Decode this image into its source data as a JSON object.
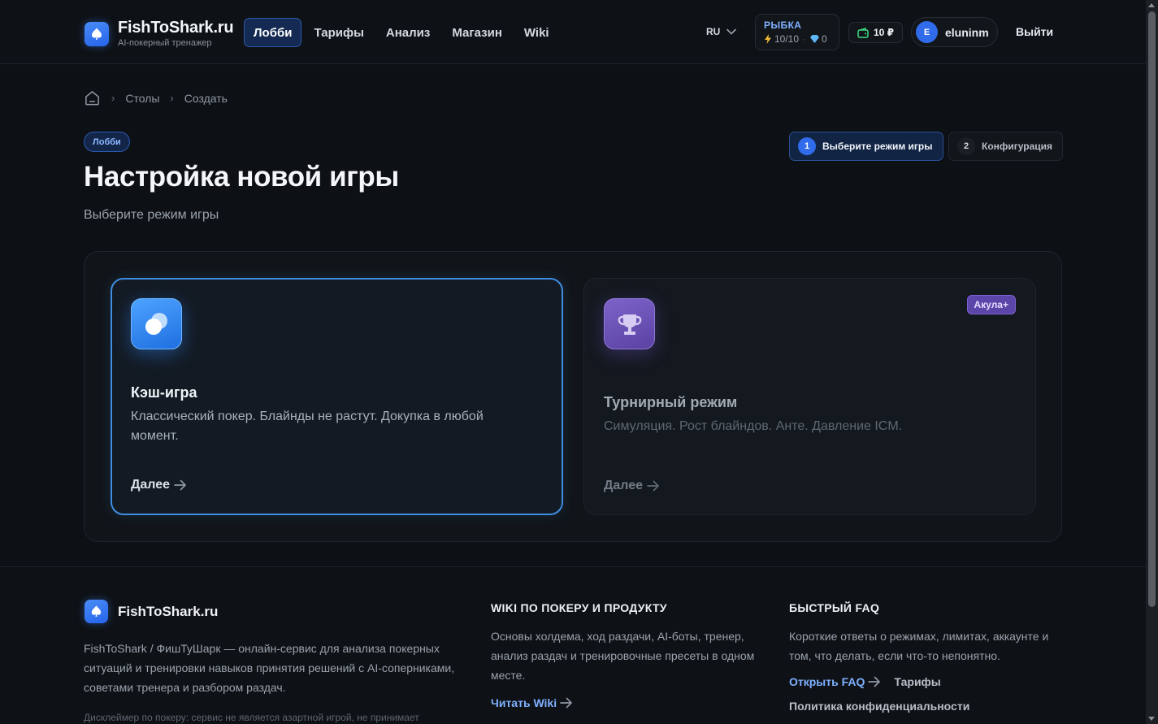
{
  "header": {
    "brand_title": "FishToShark.ru",
    "brand_subtitle": "AI-покерный тренажер",
    "nav": [
      {
        "label": "Лобби",
        "active": true
      },
      {
        "label": "Тарифы",
        "active": false
      },
      {
        "label": "Анализ",
        "active": false
      },
      {
        "label": "Магазин",
        "active": false
      },
      {
        "label": "Wiki",
        "active": false
      }
    ],
    "language": "RU",
    "rank": {
      "title": "РЫБКА",
      "energy": "10/10",
      "separator": "·",
      "gems": "0"
    },
    "wallet": "10 ₽",
    "user": {
      "initial": "E",
      "name": "eluninm"
    },
    "logout_label": "Выйти"
  },
  "breadcrumb": {
    "items": [
      "Столы",
      "Создать"
    ],
    "separator": "›"
  },
  "page": {
    "badge": "Лобби",
    "title": "Настройка новой игры",
    "subtitle": "Выберите режим игры"
  },
  "steps": [
    {
      "number": "1",
      "label": "Выберите режим игры",
      "active": true
    },
    {
      "number": "2",
      "label": "Конфигурация",
      "active": false
    }
  ],
  "modes": [
    {
      "title": "Кэш-игра",
      "description": "Классический покер. Блайнды не растут. Докупка в любой момент.",
      "next_label": "Далее",
      "selected": true,
      "icon": "chips-icon"
    },
    {
      "title": "Турнирный режим",
      "description": "Симуляция. Рост блайндов. Анте. Давление ICM.",
      "next_label": "Далее",
      "selected": false,
      "badge": "Акула+",
      "icon": "trophy-icon"
    }
  ],
  "footer": {
    "brand": "FishToShark.ru",
    "description": "FishToShark / ФишТуШарк — онлайн-сервис для анализа покерных ситуаций и тренировки навыков принятия решений с AI-соперниками, советами тренера и разбором раздач.",
    "disclaimer": "Дисклеймер по покеру: сервис не является азартной игрой, не принимает",
    "wiki": {
      "heading": "WIKI ПО ПОКЕРУ И ПРОДУКТУ",
      "text": "Основы холдема, ход раздачи, AI-боты, тренер, анализ раздач и тренировочные пресеты в одном месте.",
      "link": "Читать Wiki"
    },
    "faq": {
      "heading": "БЫСТРЫЙ FAQ",
      "text": "Короткие ответы о режимах, лимитах, аккаунте и том, что делать, если что-то непонятно.",
      "link": "Открыть FAQ",
      "tariffs": "Тарифы",
      "privacy": "Политика конфиденциальности"
    }
  },
  "colors": {
    "accent": "#2f6bea",
    "link": "#7fb0ff",
    "premium": "#5b45a8",
    "background": "#0d1014"
  }
}
